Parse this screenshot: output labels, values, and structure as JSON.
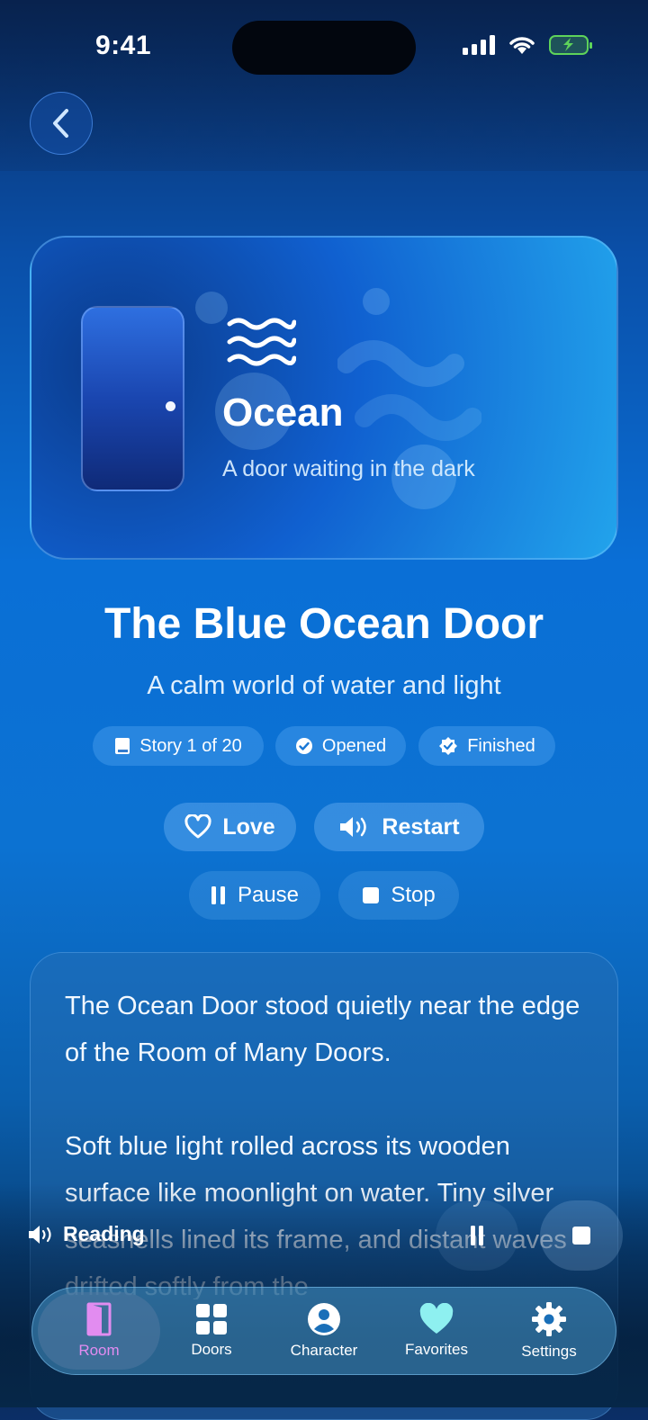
{
  "status": {
    "time": "9:41"
  },
  "hero": {
    "title": "Ocean",
    "subtitle": "A door waiting in the dark"
  },
  "story": {
    "title": "The Blue Ocean Door",
    "subtitle": "A calm world of water and light",
    "chips": [
      {
        "label": "Story 1 of 20",
        "icon": "book-icon"
      },
      {
        "label": "Opened",
        "icon": "check-circle-icon"
      },
      {
        "label": "Finished",
        "icon": "verified-badge-icon"
      }
    ],
    "actions": {
      "love": "Love",
      "restart": "Restart",
      "pause": "Pause",
      "stop": "Stop"
    },
    "paragraphs": [
      "The Ocean Door stood quietly near the edge of the Room of Many Doors.",
      "Soft blue light rolled across its wooden surface like moonlight on water. Tiny silver seashells lined its frame, and distant waves drifted softly from the"
    ]
  },
  "player": {
    "status": "Reading"
  },
  "tabs": [
    {
      "label": "Room",
      "icon": "door-icon",
      "active": true
    },
    {
      "label": "Doors",
      "icon": "grid-icon"
    },
    {
      "label": "Character",
      "icon": "person-icon"
    },
    {
      "label": "Favorites",
      "icon": "heart-icon"
    },
    {
      "label": "Settings",
      "icon": "gear-icon"
    }
  ],
  "colors": {
    "active_tab": "#e28cf0",
    "battery": "#5ed35a",
    "accent": "#0a6fd6"
  }
}
